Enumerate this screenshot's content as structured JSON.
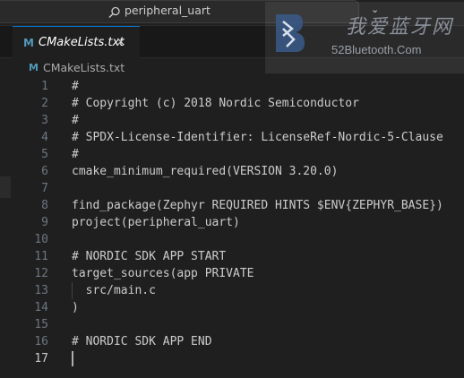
{
  "titlebar": {
    "search_text": "peripheral_uart",
    "profile_chevron": "⌄"
  },
  "watermark": {
    "cn_text": "我爱蓝牙网",
    "url_text": "52Bluetooth.Com"
  },
  "tab": {
    "file_icon": "M",
    "label": "CMakeLists.txt",
    "close": "×"
  },
  "breadcrumb": {
    "file_icon": "M",
    "label": "CMakeLists.txt"
  },
  "editor": {
    "active_line": 17,
    "lines": [
      {
        "n": "1",
        "text": "#"
      },
      {
        "n": "2",
        "text": "# Copyright (c) 2018 Nordic Semiconductor"
      },
      {
        "n": "3",
        "text": "#"
      },
      {
        "n": "4",
        "text": "# SPDX-License-Identifier: LicenseRef-Nordic-5-Clause"
      },
      {
        "n": "5",
        "text": "#"
      },
      {
        "n": "6",
        "text": "cmake_minimum_required(VERSION 3.20.0)"
      },
      {
        "n": "7",
        "text": ""
      },
      {
        "n": "8",
        "text": "find_package(Zephyr REQUIRED HINTS $ENV{ZEPHYR_BASE})"
      },
      {
        "n": "9",
        "text": "project(peripheral_uart)"
      },
      {
        "n": "10",
        "text": ""
      },
      {
        "n": "11",
        "text": "# NORDIC SDK APP START"
      },
      {
        "n": "12",
        "text": "target_sources(app PRIVATE"
      },
      {
        "n": "13",
        "text": "  src/main.c"
      },
      {
        "n": "14",
        "text": ")"
      },
      {
        "n": "15",
        "text": ""
      },
      {
        "n": "16",
        "text": "# NORDIC SDK APP END"
      },
      {
        "n": "17",
        "text": ""
      }
    ]
  }
}
